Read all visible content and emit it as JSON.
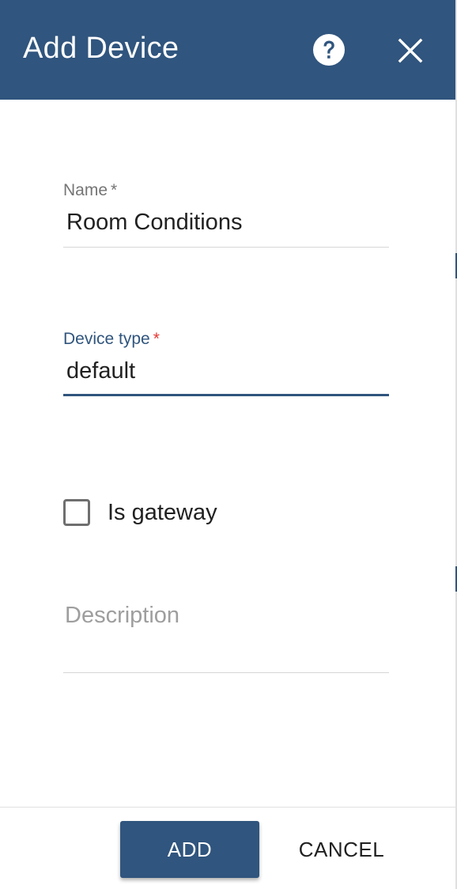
{
  "dialog": {
    "title": "Add Device",
    "help_icon": "help-circle-icon",
    "close_icon": "close-icon"
  },
  "form": {
    "name": {
      "label": "Name",
      "required_mark": "*",
      "value": "Room Conditions"
    },
    "device_type": {
      "label": "Device type",
      "required_mark": "*",
      "value": "default"
    },
    "is_gateway": {
      "label": "Is gateway",
      "checked": false
    },
    "description": {
      "placeholder": "Description",
      "value": ""
    }
  },
  "actions": {
    "add_label": "ADD",
    "cancel_label": "CANCEL"
  },
  "colors": {
    "primary": "#30557e",
    "required_active": "#e53935"
  }
}
